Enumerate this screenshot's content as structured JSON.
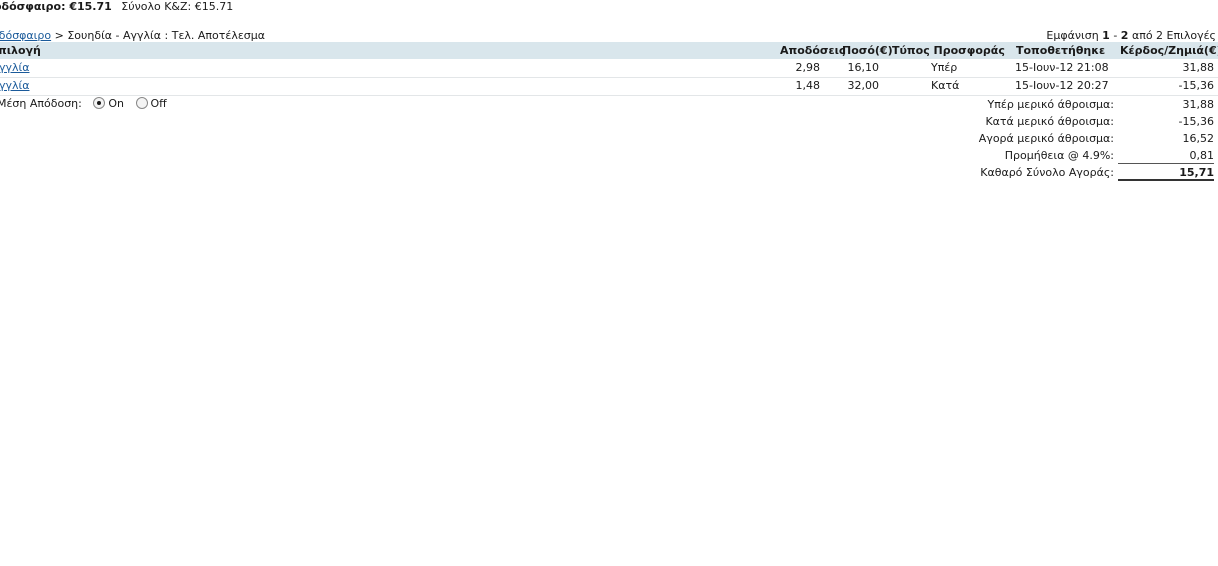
{
  "summary": {
    "label": "οδόσφαιρο: €15.71",
    "pl_label": "Σύνολο Κ&Ζ:",
    "pl_value": "€15.71"
  },
  "breadcrumb": {
    "link": "οδόσφαιρο",
    "rest": " > Σουηδία - Αγγλία : Τελ. Αποτέλεσμα"
  },
  "paging": {
    "prefix": "Εμφάνιση ",
    "from": "1",
    "dash": " - ",
    "to": "2",
    "suffix": " από 2 Επιλογές"
  },
  "table": {
    "headers": {
      "selection": "πιλογή",
      "odds": "Αποδόσεις",
      "amount": "Ποσό(€)",
      "offer_type": "Τύπος Προσφοράς",
      "placed": "Τοποθετήθηκε",
      "pl": "Κέρδος/Ζημιά(€)"
    },
    "rows": [
      {
        "selection": "γγλία",
        "odds": "2,98",
        "amount": "16,10",
        "type": "Υπέρ",
        "placed": "15-Ιουν-12 21:08",
        "pl": "31,88"
      },
      {
        "selection": "γγλία",
        "odds": "1,48",
        "amount": "32,00",
        "type": "Κατά",
        "placed": "15-Ιουν-12 20:27",
        "pl": "-15,36"
      }
    ]
  },
  "average_odds": {
    "label": "Μέση Απόδοση:",
    "on": "On",
    "off": "Off",
    "selected": "On"
  },
  "totals": [
    {
      "label": "Υπέρ μερικό άθροισμα:",
      "value": "31,88"
    },
    {
      "label": "Κατά μερικό άθροισμα:",
      "value": "-15,36"
    },
    {
      "label": "Αγορά μερικό άθροισμα:",
      "value": "16,52"
    },
    {
      "label": "Προμήθεια @ 4.9%:",
      "value": "0,81"
    },
    {
      "label": "Καθαρό Σύνολο Αγοράς:",
      "value": "15,71"
    }
  ]
}
